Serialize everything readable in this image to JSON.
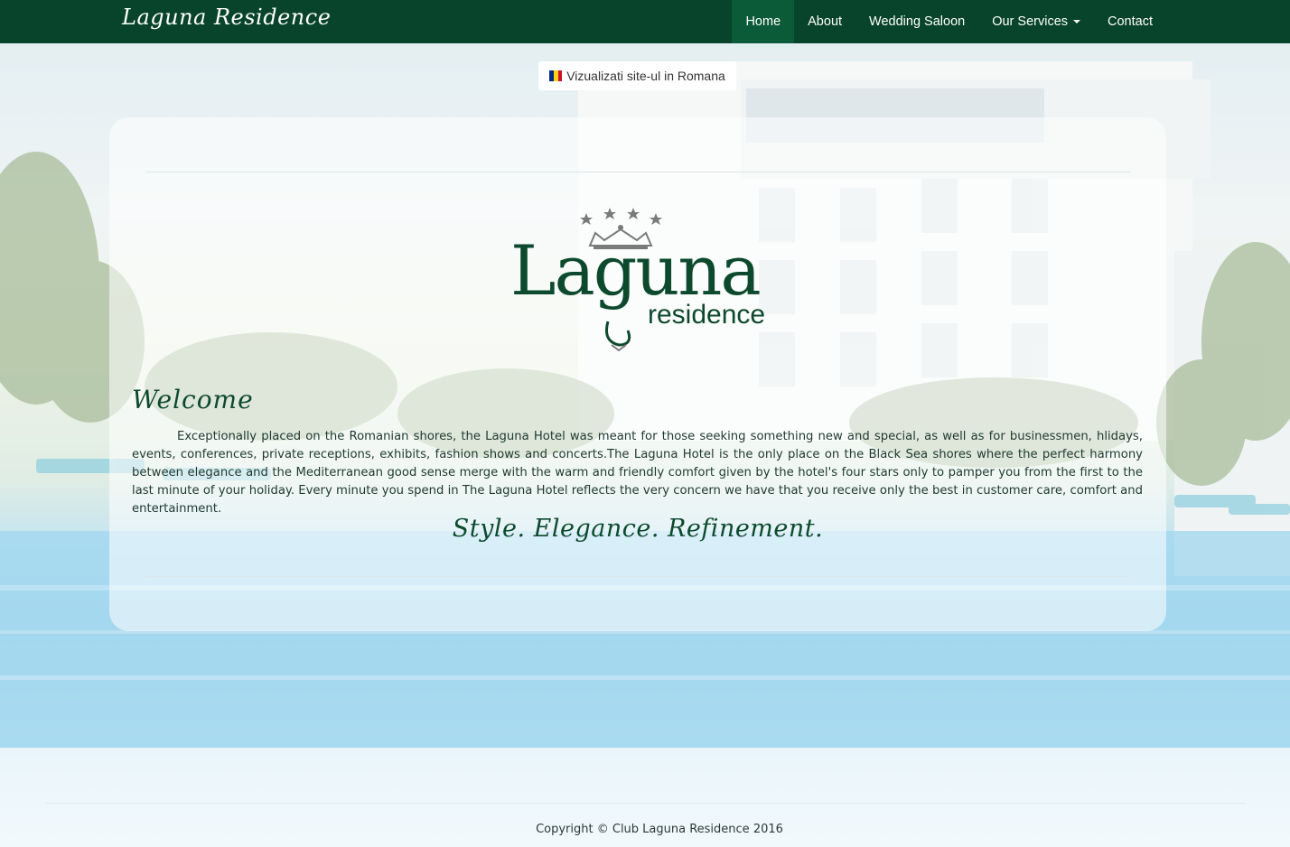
{
  "navbar": {
    "brand": "Laguna Residence",
    "items": [
      {
        "label": "Home",
        "active": true
      },
      {
        "label": "About"
      },
      {
        "label": "Wedding Saloon"
      },
      {
        "label": "Our Services",
        "dropdown": true
      },
      {
        "label": "Contact"
      }
    ]
  },
  "language_button": {
    "label": "Vizualizati site-ul in Romana",
    "flag_icon": "romania-flag-icon",
    "flag_colors": [
      "#002b7f",
      "#fcd116",
      "#ce1126"
    ]
  },
  "logo": {
    "word": "Laguna",
    "sub": "residence",
    "stars": 4
  },
  "welcome": {
    "heading": "Welcome",
    "text": "Exceptionally placed on the Romanian shores, the Laguna Hotel was meant for those seeking something new and special, as well as for businessmen, hlidays, events, conferences, private receptions, exhibits, fashion shows and concerts.The Laguna Hotel is the only place on the Black Sea shores where the perfect harmony between elegance and the Mediterranean good sense merge with the warm and friendly comfort given by the hotel's four stars only to pamper you from the first to the last minute of your holiday. Every minute you spend in The Laguna Hotel reflects the very concern we have that you receive only the best in customer care, comfort and entertainment.",
    "tagline": "Style. Elegance. Refinement."
  },
  "footer": {
    "copyright": "Copyright © Club Laguna Residence 2016"
  },
  "colors": {
    "brand_green": "#07442b",
    "active_nav": "#0b5a38",
    "text_green": "#0d4a2d"
  }
}
